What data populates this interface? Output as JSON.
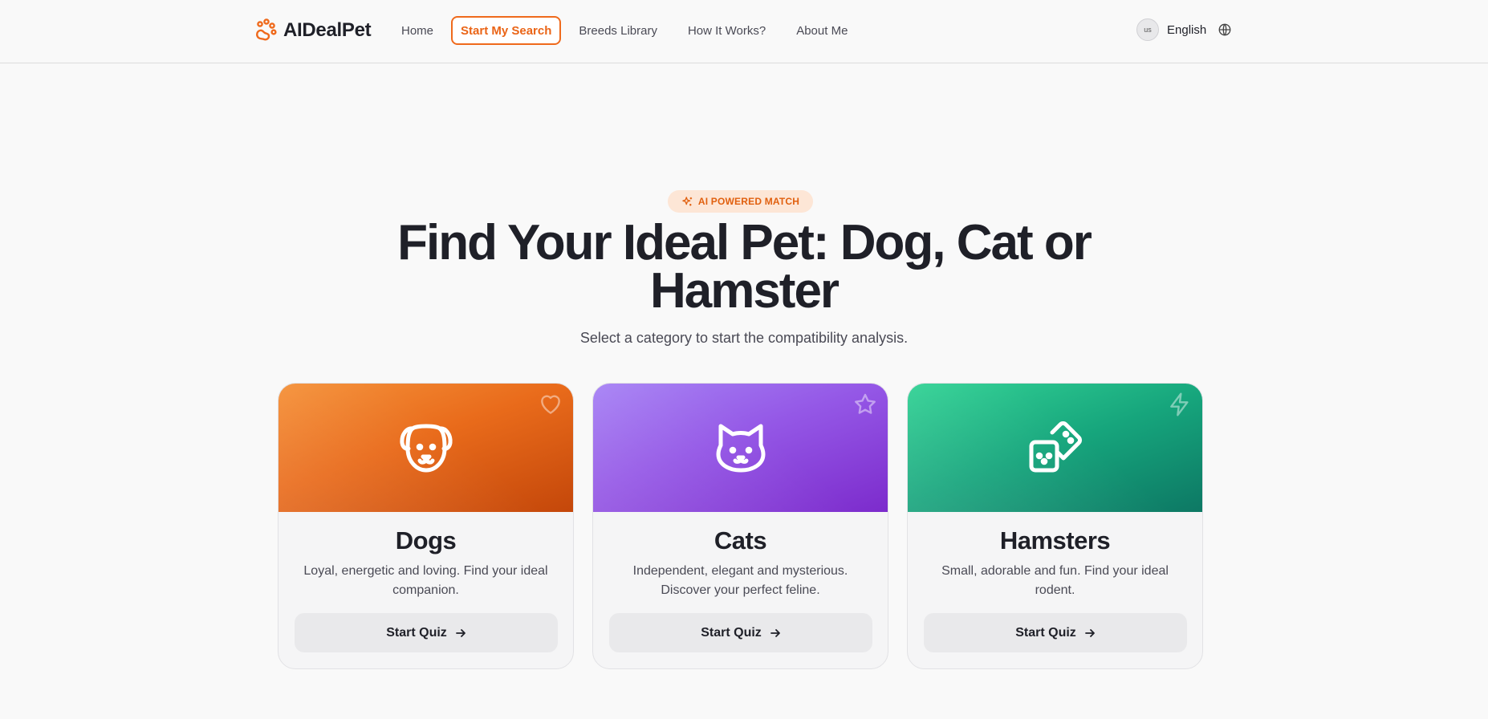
{
  "header": {
    "logo_text": "AIDealPet",
    "nav": [
      {
        "label": "Home"
      },
      {
        "label": "Start My Search"
      },
      {
        "label": "Breeds Library"
      },
      {
        "label": "How It Works?"
      },
      {
        "label": "About Me"
      }
    ],
    "active_nav": "Start My Search",
    "language": {
      "flag_code": "us",
      "label": "English"
    }
  },
  "hero": {
    "badge": "AI POWERED MATCH",
    "title": "Find Your Ideal Pet: Dog, Cat or Hamster",
    "subtitle": "Select a category to start the compatibility analysis."
  },
  "cards": [
    {
      "title": "Dogs",
      "description": "Loyal, energetic and loving. Find your ideal companion.",
      "button": "Start Quiz",
      "main_icon": "dog-face-icon",
      "corner_icon": "heart-icon",
      "color": "#e96b1b"
    },
    {
      "title": "Cats",
      "description": "Independent, elegant and mysterious. Discover your perfect feline.",
      "button": "Start Quiz",
      "main_icon": "cat-face-icon",
      "corner_icon": "star-icon",
      "color": "#9457e6"
    },
    {
      "title": "Hamsters",
      "description": "Small, adorable and fun. Find your ideal rodent.",
      "button": "Start Quiz",
      "main_icon": "dice-icon",
      "corner_icon": "lightning-icon",
      "color": "#16a57c"
    }
  ],
  "colors": {
    "accent": "#ea6416",
    "badge_bg": "#fde6d6",
    "text": "#1f2028",
    "page_bg": "#f9f9f9"
  }
}
